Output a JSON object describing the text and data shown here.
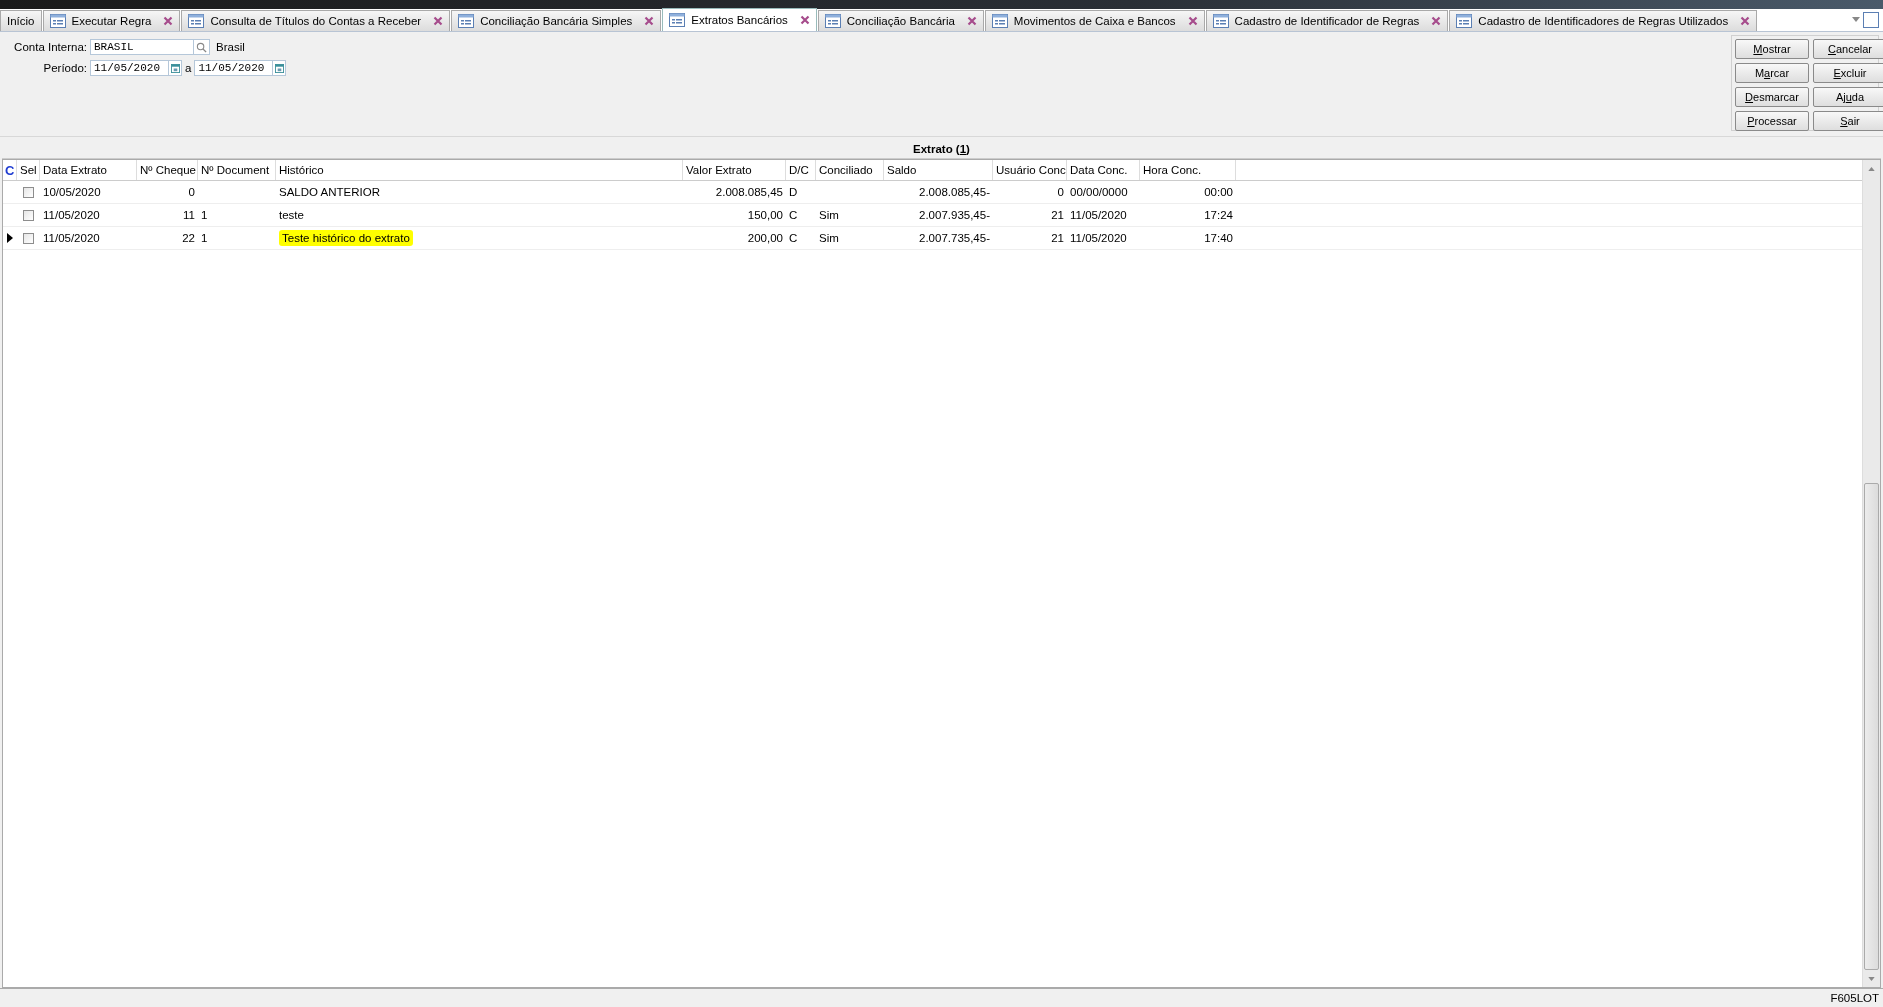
{
  "tabs": [
    {
      "label": "Início",
      "kind": "home",
      "selected": false
    },
    {
      "label": "Executar Regra",
      "kind": "form",
      "selected": false
    },
    {
      "label": "Consulta de Títulos do Contas a Receber",
      "kind": "form",
      "selected": false
    },
    {
      "label": "Conciliação Bancária Simples",
      "kind": "form",
      "selected": false
    },
    {
      "label": "Extratos Bancários",
      "kind": "form",
      "selected": true
    },
    {
      "label": "Conciliação Bancária",
      "kind": "form",
      "selected": false
    },
    {
      "label": "Movimentos de Caixa e Bancos",
      "kind": "form",
      "selected": false
    },
    {
      "label": "Cadastro de Identificador de Regras",
      "kind": "form",
      "selected": false
    },
    {
      "label": "Cadastro de Identificadores de Regras Utilizados",
      "kind": "form",
      "selected": false
    }
  ],
  "filters": {
    "conta_interna": {
      "label": "Conta Interna:",
      "value": "BRASIL",
      "description": "Brasil"
    },
    "periodo": {
      "label": "Período:",
      "from": "11/05/2020",
      "separator": "a",
      "to": "11/05/2020"
    }
  },
  "buttons": [
    {
      "key": "M",
      "after": "ostrar"
    },
    {
      "key": "C",
      "after": "ancelar"
    },
    {
      "before": "M",
      "key": "a",
      "after": "rcar"
    },
    {
      "key": "E",
      "after": "xcluir"
    },
    {
      "key": "D",
      "after": "esmarcar"
    },
    {
      "before": "Aj",
      "key": "u",
      "after": "da"
    },
    {
      "key": "P",
      "after": "rocessar"
    },
    {
      "key": "S",
      "after": "air"
    }
  ],
  "grid": {
    "title": {
      "before": "Extrato (",
      "key": "1",
      "after": ")"
    },
    "indicator_header": "C",
    "select_header": "Sel",
    "columns": [
      "Data Extrato",
      "Nº Cheque",
      "Nº Document",
      "Histórico",
      "Valor Extrato",
      "D/C",
      "Conciliado",
      "Saldo",
      "Usuário Conc",
      "Data Conc.",
      "Hora Conc."
    ],
    "rows": [
      {
        "current": false,
        "checked": false,
        "highlighted": false,
        "cells": [
          "10/05/2020",
          "0",
          "",
          "SALDO ANTERIOR",
          "2.008.085,45",
          "D",
          "",
          "2.008.085,45-",
          "0",
          "00/00/0000",
          "00:00"
        ]
      },
      {
        "current": false,
        "checked": false,
        "highlighted": false,
        "cells": [
          "11/05/2020",
          "11",
          "1",
          "teste",
          "150,00",
          "C",
          "Sim",
          "2.007.935,45-",
          "21",
          "11/05/2020",
          "17:24"
        ]
      },
      {
        "current": true,
        "checked": false,
        "highlighted": true,
        "cells": [
          "11/05/2020",
          "22",
          "1",
          "Teste histórico do extrato",
          "200,00",
          "C",
          "Sim",
          "2.007.735,45-",
          "21",
          "11/05/2020",
          "17:40"
        ]
      }
    ]
  },
  "status_bar": {
    "code": "F605LOT"
  }
}
